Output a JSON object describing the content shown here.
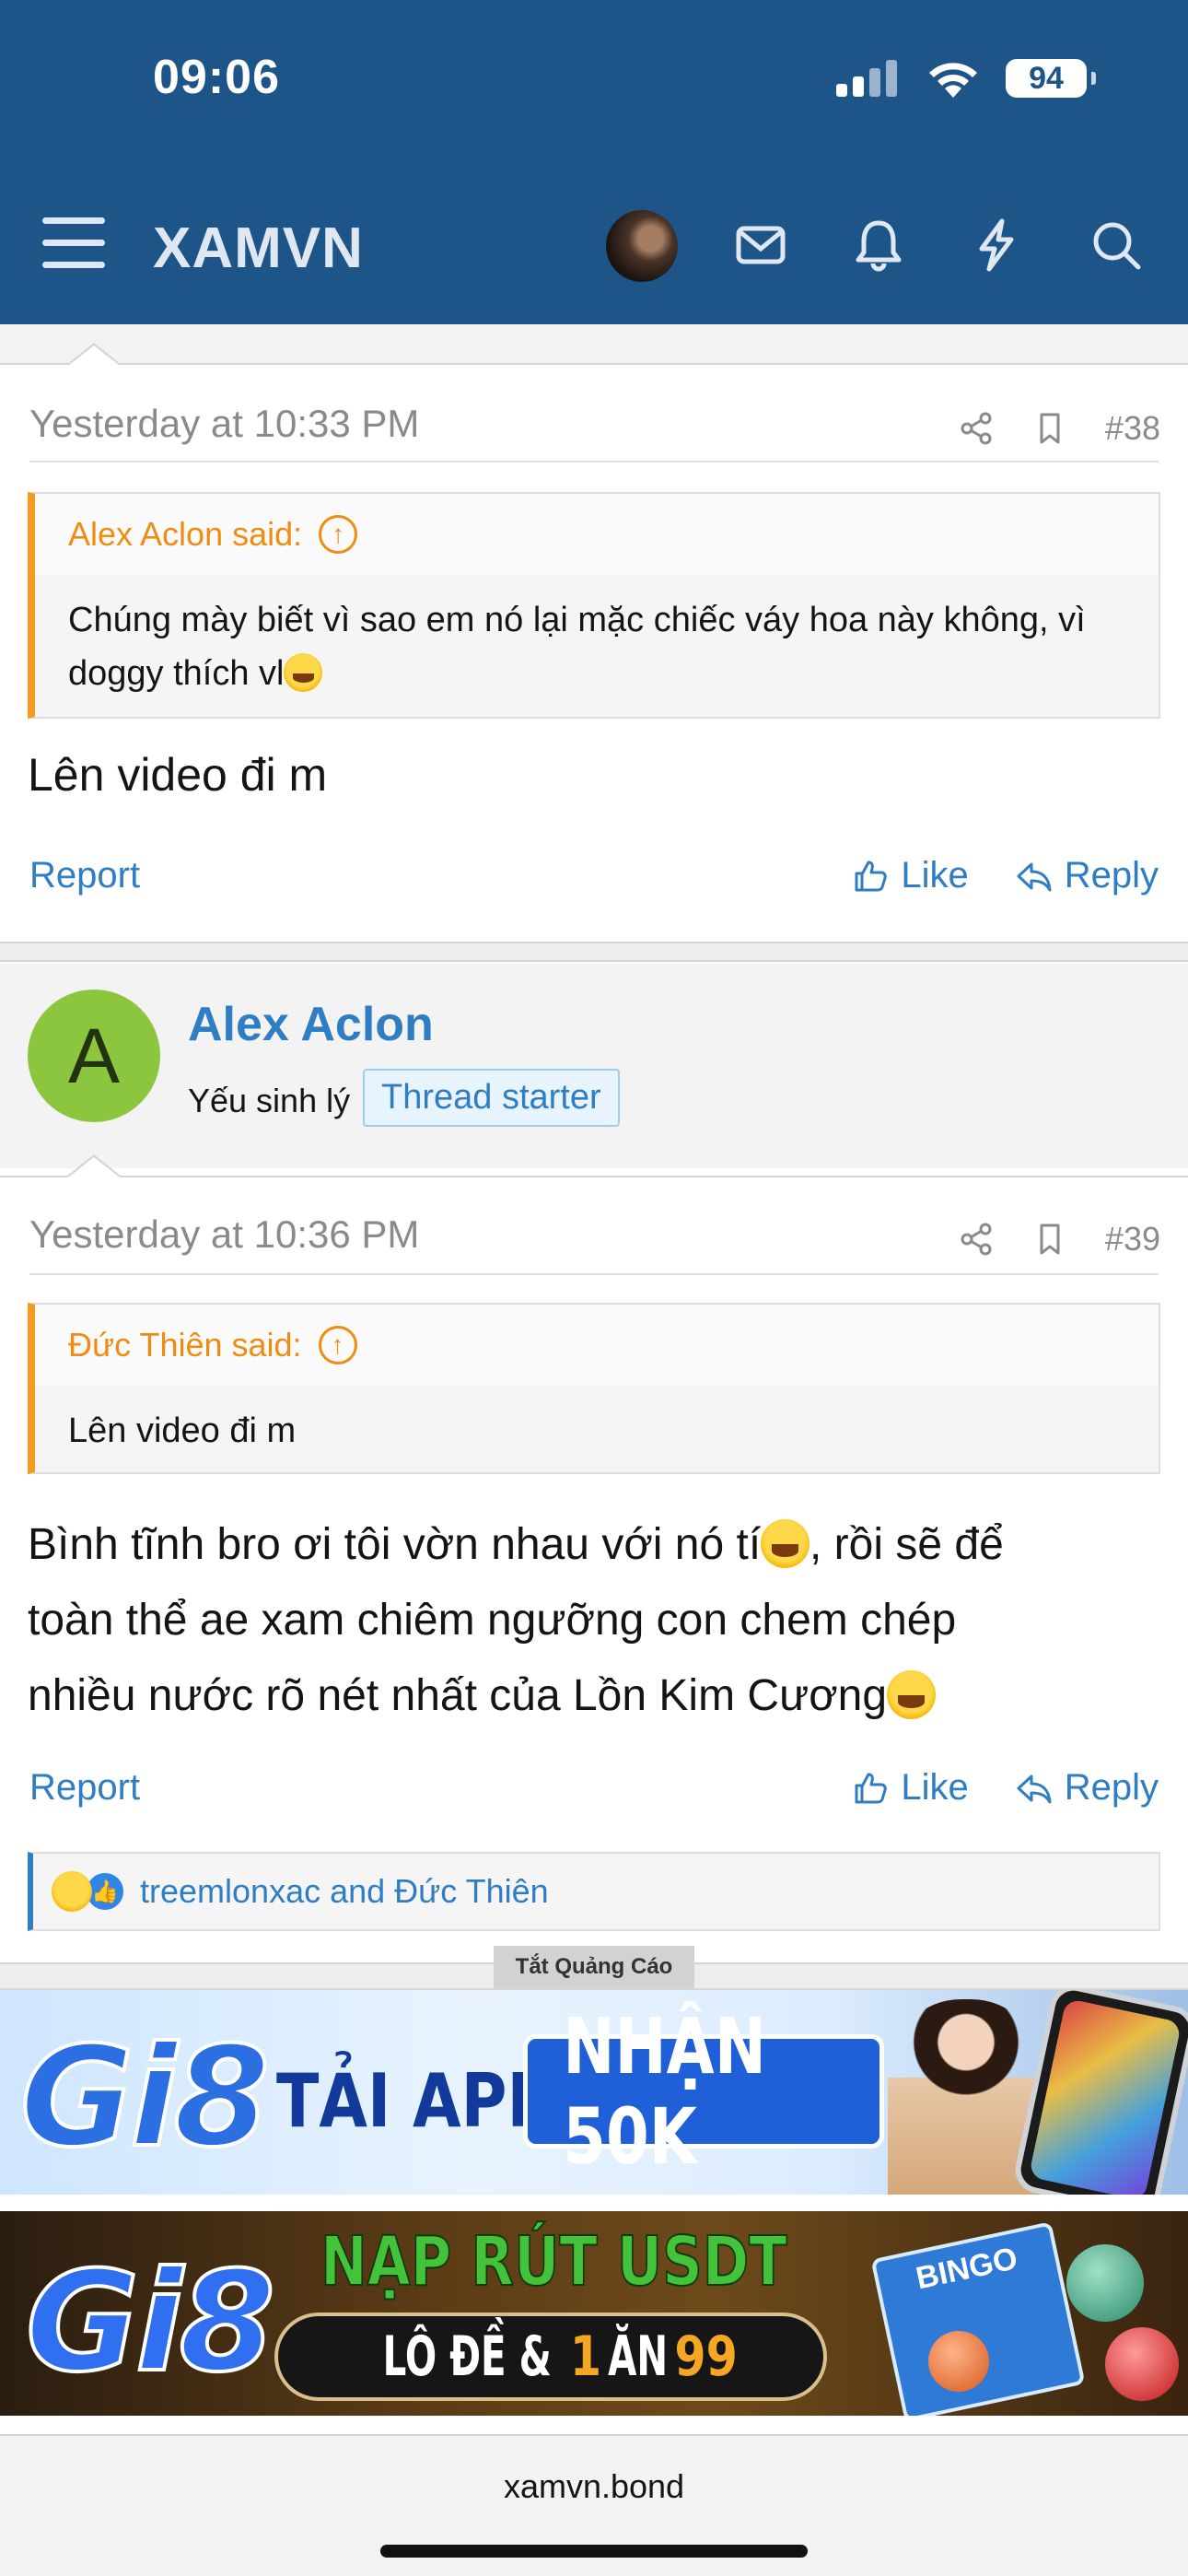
{
  "status": {
    "time": "09:06",
    "battery": "94"
  },
  "header": {
    "logo": "XAMVN",
    "icons": [
      "menu-icon",
      "avatar",
      "envelope-icon",
      "bell-icon",
      "lightning-icon",
      "search-icon"
    ]
  },
  "post38": {
    "time": "Yesterday at 10:33 PM",
    "number": "#38",
    "quote_author": "Alex Aclon said:",
    "quote_text": "Chúng mày biết vì sao em nó lại mặc chiếc váy hoa này không, vì doggy thích vl",
    "body": "Lên video đi m",
    "report": "Report",
    "like": "Like",
    "reply": "Reply"
  },
  "author": {
    "initial": "A",
    "name": "Alex Aclon",
    "title": "Yếu sinh lý",
    "badge": "Thread starter",
    "avatar_color": "#8cc63f"
  },
  "post39": {
    "time": "Yesterday at 10:36 PM",
    "number": "#39",
    "quote_author": "Đức Thiên said:",
    "quote_text": "Lên video đi m",
    "body_line1": "Bình tĩnh bro ơi tôi vờn nhau với nó tí",
    "body_line1_tail": ", rồi sẽ để",
    "body_line2": "toàn thể ae xam chiêm ngưỡng con chem chép",
    "body_line3": "nhiều nước rõ nét nhất của Lồn Kim Cương",
    "report": "Report",
    "like": "Like",
    "reply": "Reply",
    "reactions": "treemlonxac and Đức Thiên"
  },
  "ads": {
    "close_label": "Tắt Quảng Cáo",
    "ad1_brand": "Gi8",
    "ad1_text": "TẢI APP",
    "ad1_button": "NHẬN 50K",
    "ad2_brand": "Gi8",
    "ad2_title": "NẠP RÚT USDT",
    "ad2_sub_a": "LÔ ĐỀ & ",
    "ad2_sub_b": "1",
    "ad2_sub_c": " ĂN ",
    "ad2_sub_d": "99",
    "ad2_bingo": "BINGO"
  },
  "footer": {
    "url": "xamvn.bond"
  },
  "colors": {
    "header": "#1d5588",
    "link": "#2f7dc2",
    "quote_accent": "#f59b22"
  }
}
